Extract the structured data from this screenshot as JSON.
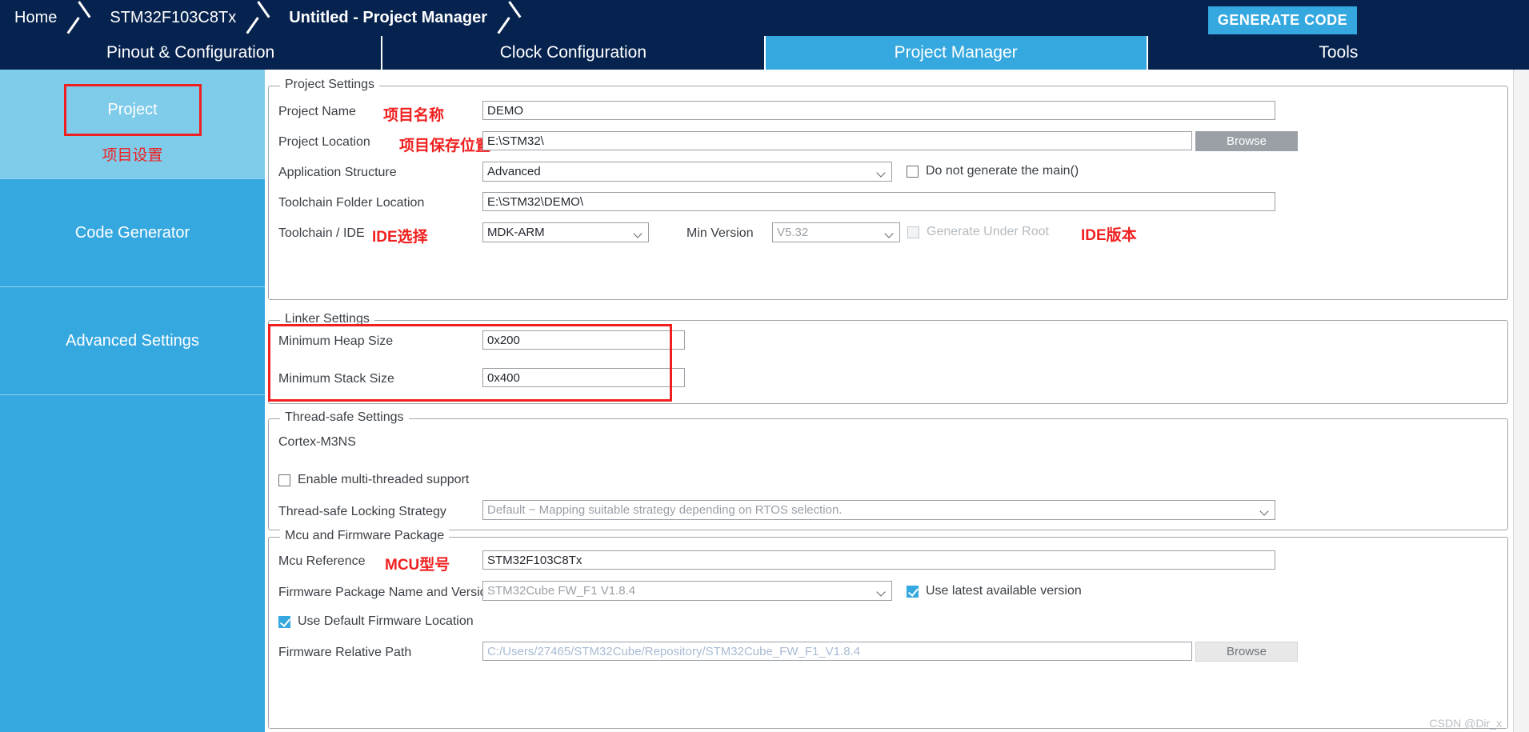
{
  "colors": {
    "navy": "#06234f",
    "accent_blue": "#35a8e0",
    "light_blue": "#7fcbea",
    "annotation_red": "#f02020"
  },
  "breadcrumb": {
    "items": [
      {
        "label": "Home",
        "active": false
      },
      {
        "label": "STM32F103C8Tx",
        "active": false
      },
      {
        "label": "Untitled - Project Manager",
        "active": true
      }
    ]
  },
  "toolbar": {
    "generate_code_label": "GENERATE CODE"
  },
  "tabs": [
    {
      "label": "Pinout & Configuration",
      "selected": false
    },
    {
      "label": "Clock Configuration",
      "selected": false
    },
    {
      "label": "Project Manager",
      "selected": true
    },
    {
      "label": "Tools",
      "selected": false
    }
  ],
  "sidebar": {
    "items": [
      {
        "label": "Project",
        "selected": true,
        "annotation": "项目设置"
      },
      {
        "label": "Code Generator",
        "selected": false,
        "annotation": ""
      },
      {
        "label": "Advanced Settings",
        "selected": false,
        "annotation": ""
      }
    ]
  },
  "project_settings": {
    "title": "Project Settings",
    "project_name": {
      "label": "Project Name",
      "annotation": "项目名称",
      "value": "DEMO"
    },
    "project_location": {
      "label": "Project Location",
      "annotation": "项目保存位置",
      "value": "E:\\STM32\\",
      "browse_label": "Browse"
    },
    "application_structure": {
      "label": "Application Structure",
      "value": "Advanced",
      "do_not_generate_main_label": "Do not generate the main()",
      "do_not_generate_main_checked": false
    },
    "toolchain_folder_location": {
      "label": "Toolchain Folder Location",
      "value": "E:\\STM32\\DEMO\\"
    },
    "toolchain_ide": {
      "label": "Toolchain / IDE",
      "annotation": "IDE选择",
      "value": "MDK-ARM",
      "min_version_label": "Min Version",
      "min_version_value": "V5.32",
      "min_version_annotation": "IDE版本",
      "generate_under_root_label": "Generate Under Root",
      "generate_under_root_checked": false,
      "generate_under_root_disabled": true
    }
  },
  "linker_settings": {
    "title": "Linker Settings",
    "minimum_heap_size": {
      "label": "Minimum Heap Size",
      "value": "0x200"
    },
    "minimum_stack_size": {
      "label": "Minimum Stack Size",
      "value": "0x400"
    }
  },
  "thread_safe_settings": {
    "title": "Thread-safe Settings",
    "core_label": "Cortex-M3NS",
    "enable_multithreaded": {
      "label": "Enable multi-threaded support",
      "checked": false
    },
    "locking_strategy": {
      "label": "Thread-safe Locking Strategy",
      "value": "Default  −  Mapping suitable strategy depending on RTOS selection."
    }
  },
  "mcu_firmware_package": {
    "title": "Mcu and Firmware Package",
    "mcu_reference": {
      "label": "Mcu Reference",
      "annotation": "MCU型号",
      "value": "STM32F103C8Tx"
    },
    "firmware_package": {
      "label": "Firmware Package Name and Version",
      "value": "STM32Cube FW_F1 V1.8.4",
      "use_latest_label": "Use latest available version",
      "use_latest_checked": true
    },
    "use_default_firmware_location": {
      "label": "Use Default Firmware Location",
      "checked": true
    },
    "firmware_relative_path": {
      "label": "Firmware Relative Path",
      "value": "C:/Users/27465/STM32Cube/Repository/STM32Cube_FW_F1_V1.8.4",
      "browse_label": "Browse"
    }
  },
  "watermark": {
    "text": "CSDN @Dir_x"
  }
}
